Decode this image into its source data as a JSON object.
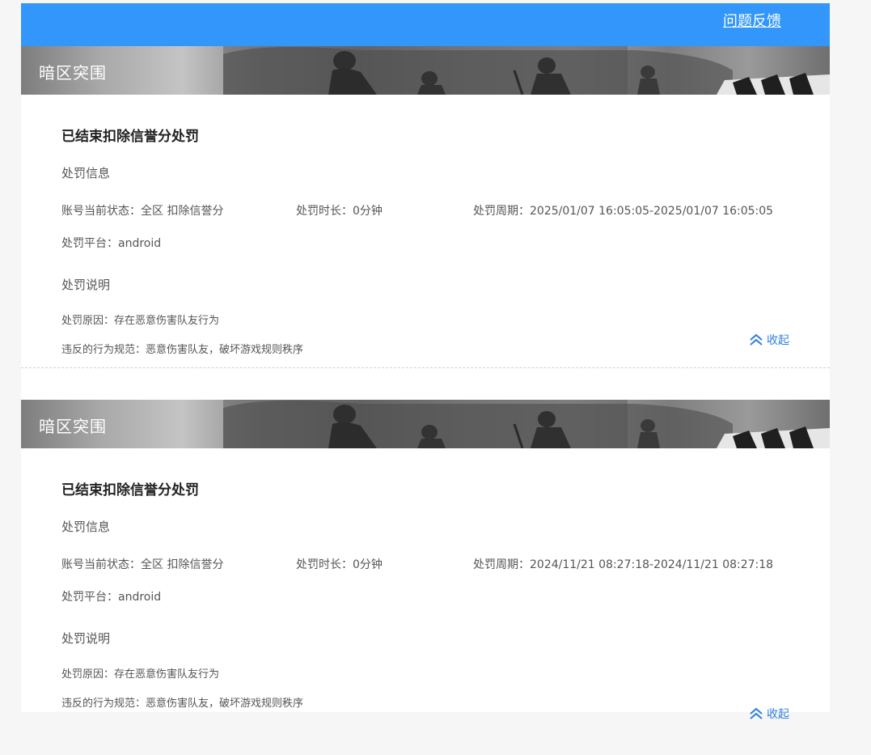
{
  "header": {
    "feedback_label": "问题反馈"
  },
  "records": [
    {
      "game_title": "暗区突围",
      "status_title": "已结束扣除信誉分处罚",
      "info_section": "处罚信息",
      "account_status": "账号当前状态：全区 扣除信誉分",
      "duration": "处罚时长：0分钟",
      "period": "处罚周期：2025/01/07 16:05:05-2025/01/07 16:05:05",
      "platform": "处罚平台：android",
      "explain_section": "处罚说明",
      "reason": "处罚原因：存在恶意伤害队友行为",
      "violation": "违反的行为规范：恶意伤害队友，破坏游戏规则秩序",
      "collapse_label": "收起"
    },
    {
      "game_title": "暗区突围",
      "status_title": "已结束扣除信誉分处罚",
      "info_section": "处罚信息",
      "account_status": "账号当前状态：全区 扣除信誉分",
      "duration": "处罚时长：0分钟",
      "period": "处罚周期：2024/11/21 08:27:18-2024/11/21 08:27:18",
      "platform": "处罚平台：android",
      "explain_section": "处罚说明",
      "reason": "处罚原因：存在恶意伤害队友行为",
      "violation": "违反的行为规范：恶意伤害队友，破坏游戏规则秩序",
      "collapse_label": "收起"
    }
  ],
  "colors": {
    "topbar": "#3296fa",
    "link": "#2f7fe0"
  },
  "icons": {
    "collapse": "double-chevron-up-icon"
  }
}
